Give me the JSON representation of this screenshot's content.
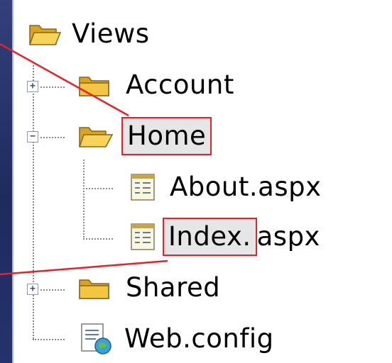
{
  "tree": {
    "root": {
      "label": "Views",
      "icon": "folder-open-icon"
    },
    "items": [
      {
        "label": "Account",
        "icon": "folder-icon",
        "expander": "+"
      },
      {
        "label": "Home",
        "icon": "folder-open-icon",
        "expander": "−",
        "highlighted": true
      },
      {
        "label": "About.aspx",
        "icon": "aspx-page-icon"
      },
      {
        "label": "Index.",
        "suffix": "aspx",
        "icon": "aspx-page-icon",
        "highlighted": true
      },
      {
        "label": "Shared",
        "icon": "folder-icon",
        "expander": "+"
      },
      {
        "label": "Web.config",
        "icon": "config-file-icon"
      }
    ]
  },
  "colors": {
    "highlight_border": "#e8202a",
    "folder": "#f4c542"
  }
}
